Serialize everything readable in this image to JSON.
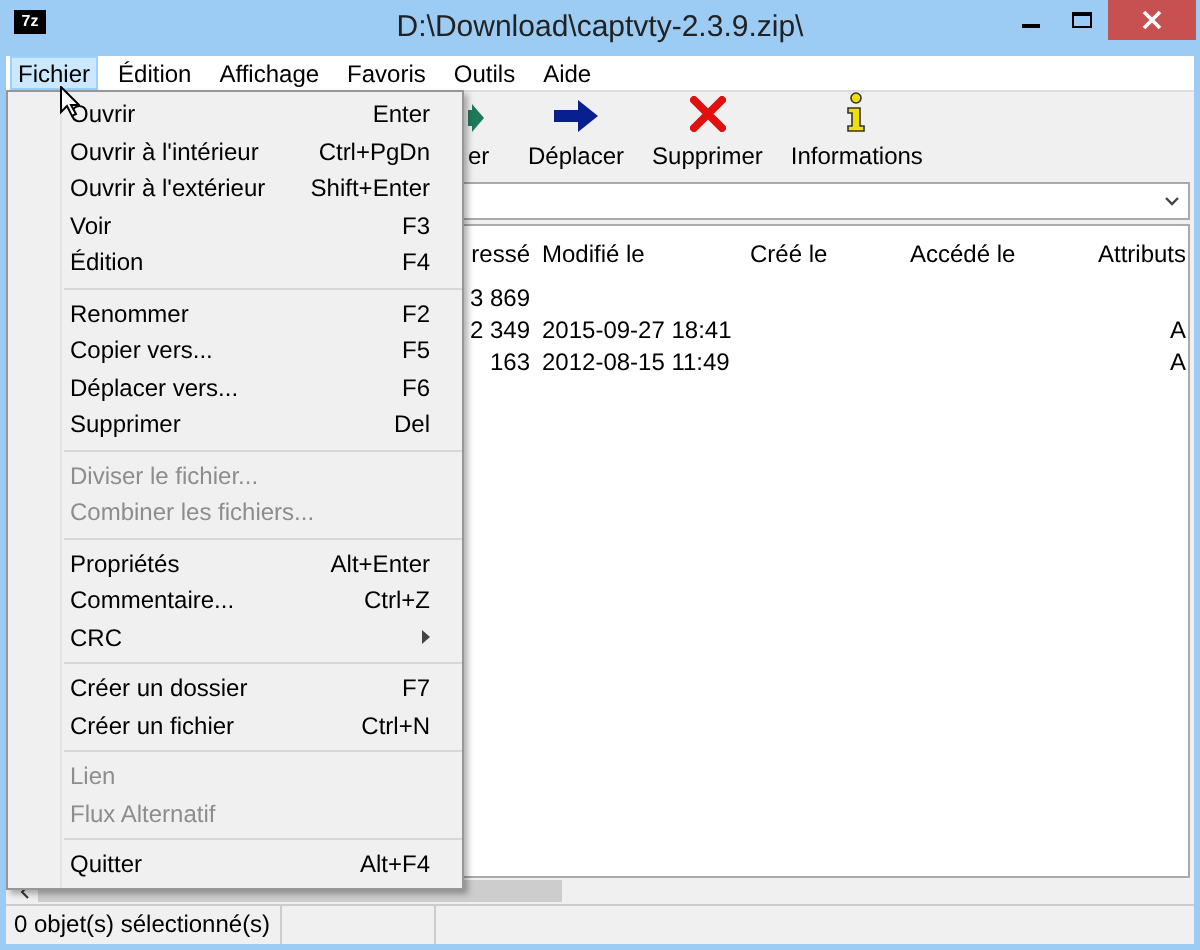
{
  "window": {
    "title": "D:\\Download\\captvty-2.3.9.zip\\",
    "app_icon": "7z"
  },
  "menubar": [
    {
      "label": "Fichier",
      "selected": true
    },
    {
      "label": "Édition",
      "selected": false
    },
    {
      "label": "Affichage",
      "selected": false
    },
    {
      "label": "Favoris",
      "selected": false
    },
    {
      "label": "Outils",
      "selected": false
    },
    {
      "label": "Aide",
      "selected": false
    }
  ],
  "toolbar": [
    {
      "label": "er",
      "kind": "partial"
    },
    {
      "label": "Déplacer",
      "kind": "move"
    },
    {
      "label": "Supprimer",
      "kind": "delete"
    },
    {
      "label": "Informations",
      "kind": "info"
    }
  ],
  "table": {
    "columns": [
      "ressé",
      "Modifié le",
      "Créé le",
      "Accédé le",
      "Attributs"
    ],
    "rows": [
      [
        "3 869",
        "",
        "",
        "",
        ""
      ],
      [
        "2 349",
        "2015-09-27 18:41",
        "",
        "",
        "A"
      ],
      [
        "163",
        "2012-08-15 11:49",
        "",
        "",
        "A"
      ]
    ]
  },
  "menu": {
    "groups": [
      [
        {
          "label": "Ouvrir",
          "shortcut": "Enter",
          "disabled": false,
          "kind": "command"
        },
        {
          "label": "Ouvrir à l'intérieur",
          "shortcut": "Ctrl+PgDn",
          "disabled": false,
          "kind": "command"
        },
        {
          "label": "Ouvrir à l'extérieur",
          "shortcut": "Shift+Enter",
          "disabled": false,
          "kind": "command"
        },
        {
          "label": "Voir",
          "shortcut": "F3",
          "disabled": false,
          "kind": "command"
        },
        {
          "label": "Édition",
          "shortcut": "F4",
          "disabled": false,
          "kind": "command"
        }
      ],
      [
        {
          "label": "Renommer",
          "shortcut": "F2",
          "disabled": false,
          "kind": "command"
        },
        {
          "label": "Copier vers...",
          "shortcut": "F5",
          "disabled": false,
          "kind": "command"
        },
        {
          "label": "Déplacer vers...",
          "shortcut": "F6",
          "disabled": false,
          "kind": "command"
        },
        {
          "label": "Supprimer",
          "shortcut": "Del",
          "disabled": false,
          "kind": "command"
        }
      ],
      [
        {
          "label": "Diviser le fichier...",
          "disabled": true,
          "kind": "command"
        },
        {
          "label": "Combiner les fichiers...",
          "disabled": true,
          "kind": "command"
        }
      ],
      [
        {
          "label": "Propriétés",
          "shortcut": "Alt+Enter",
          "disabled": false,
          "kind": "command"
        },
        {
          "label": "Commentaire...",
          "shortcut": "Ctrl+Z",
          "disabled": false,
          "kind": "command"
        },
        {
          "label": "CRC",
          "disabled": false,
          "kind": "submenu"
        }
      ],
      [
        {
          "label": "Créer un dossier",
          "shortcut": "F7",
          "disabled": false,
          "kind": "command"
        },
        {
          "label": "Créer un fichier",
          "shortcut": "Ctrl+N",
          "disabled": false,
          "kind": "command"
        }
      ],
      [
        {
          "label": "Lien",
          "disabled": true,
          "kind": "command"
        },
        {
          "label": "Flux Alternatif",
          "disabled": true,
          "kind": "command"
        }
      ],
      [
        {
          "label": "Quitter",
          "shortcut": "Alt+F4",
          "disabled": false,
          "kind": "command"
        }
      ]
    ]
  },
  "status_bar": [
    "0 objet(s) sélectionné(s)"
  ]
}
